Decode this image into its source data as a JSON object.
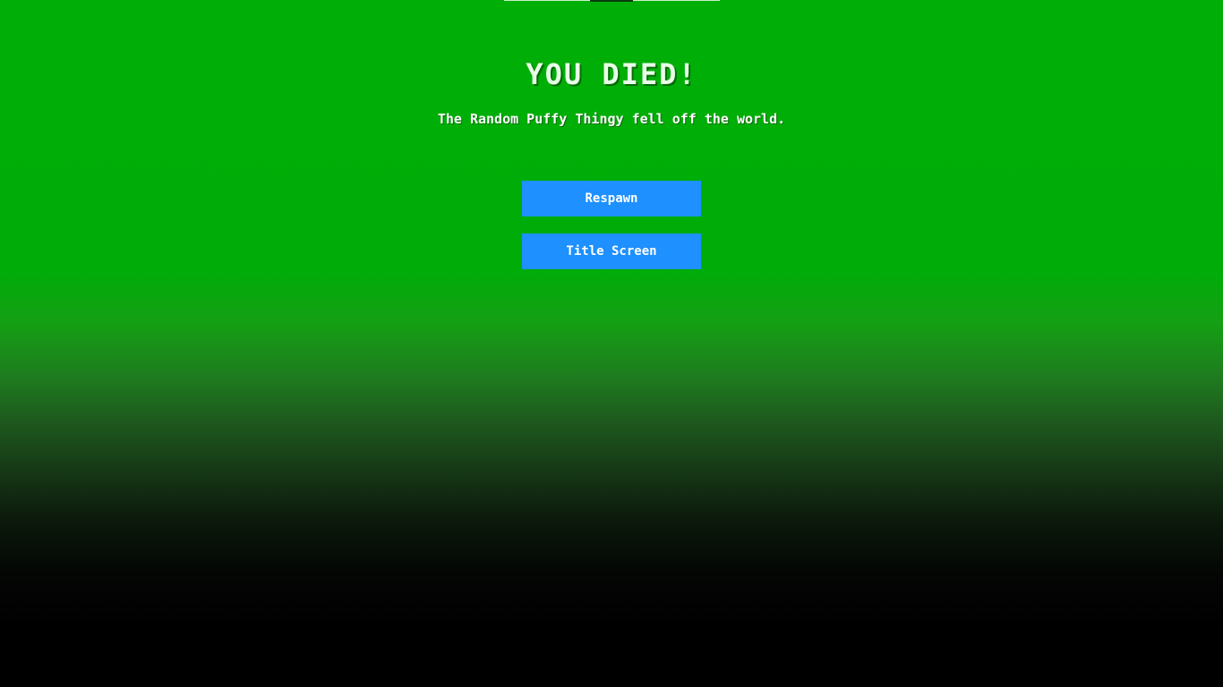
{
  "death_screen": {
    "title": "YOU DIED!",
    "message": "The Random Puffy Thingy fell off the world.",
    "buttons": {
      "respawn": "Respawn",
      "title_screen": "Title Screen"
    }
  },
  "colors": {
    "background_top": "#00ae08",
    "background_bottom": "#000000",
    "button": "#1e90ff",
    "text": "#ffffff"
  }
}
